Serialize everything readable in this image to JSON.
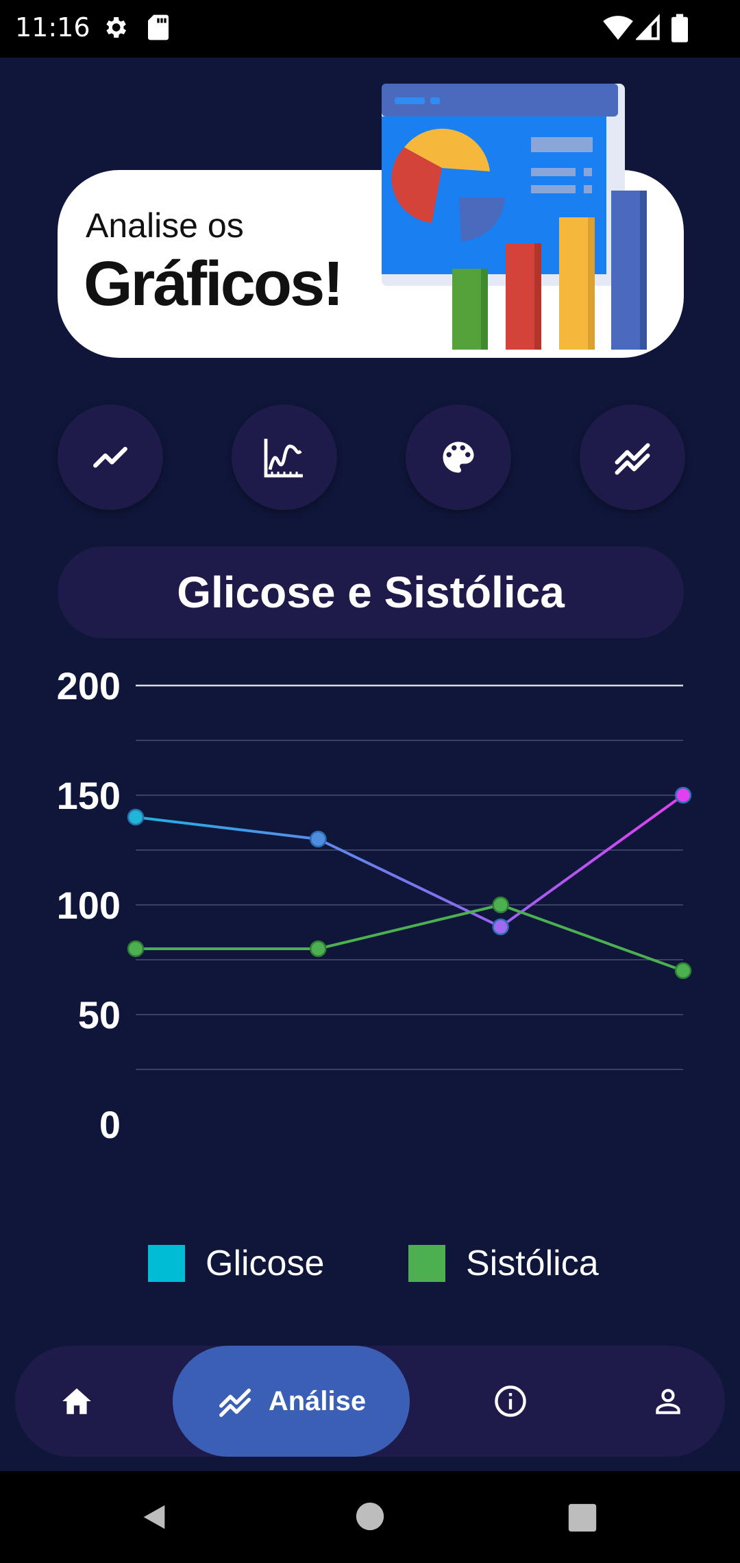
{
  "status_bar": {
    "time": "11:16",
    "icons": [
      "gear-icon",
      "sd-card-icon",
      "wifi-icon",
      "signal-icon",
      "battery-icon"
    ]
  },
  "hero": {
    "subtitle": "Analise os",
    "title": "Gráficos!"
  },
  "chart_buttons": [
    "line-chart-icon",
    "area-chart-icon",
    "palette-icon",
    "multi-line-icon"
  ],
  "chart_title": "Glicose e Sistólica",
  "chart_data": {
    "type": "line",
    "x": [
      0,
      1,
      2,
      3
    ],
    "ylim": [
      0,
      200
    ],
    "y_ticks": [
      "200",
      "150",
      "100",
      "50",
      "0"
    ],
    "grid": true,
    "series": [
      {
        "name": "Glicose",
        "values": [
          140,
          130,
          90,
          150
        ],
        "color": "#00bcd4"
      },
      {
        "name": "Sistólica",
        "values": [
          80,
          80,
          100,
          70
        ],
        "color": "#4caf50"
      }
    ],
    "legend_position": "bottom"
  },
  "bottom_nav": {
    "items": [
      {
        "icon": "home-icon",
        "label": ""
      },
      {
        "icon": "analysis-icon",
        "label": "Análise",
        "active": true
      },
      {
        "icon": "info-icon",
        "label": ""
      },
      {
        "icon": "profile-icon",
        "label": ""
      }
    ],
    "active_label": "Análise"
  },
  "colors": {
    "background": "#10163a",
    "card": "#1e1b4b",
    "accent": "#3a5fb5"
  }
}
